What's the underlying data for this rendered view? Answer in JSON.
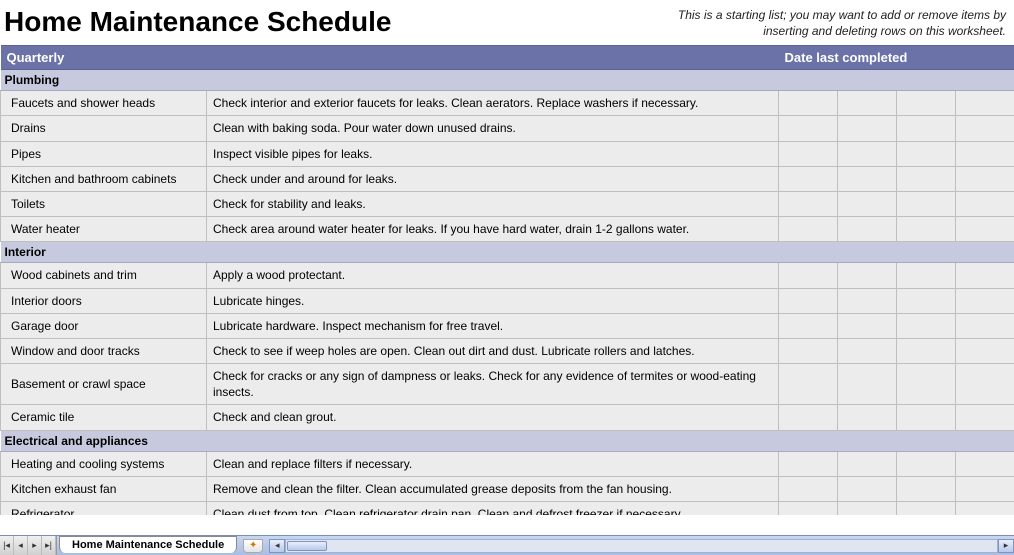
{
  "title": "Home Maintenance Schedule",
  "note": "This is a starting list; you may want to add or remove items by inserting and deleting rows on this worksheet.",
  "header": {
    "left": "Quarterly",
    "right": "Date last completed"
  },
  "sections": [
    {
      "name": "Plumbing",
      "rows": [
        {
          "item": "Faucets and shower heads",
          "desc": "Check interior and exterior faucets for leaks. Clean aerators. Replace washers if necessary."
        },
        {
          "item": "Drains",
          "desc": "Clean with baking soda. Pour water down unused drains."
        },
        {
          "item": "Pipes",
          "desc": "Inspect visible pipes for leaks."
        },
        {
          "item": "Kitchen and bathroom cabinets",
          "desc": "Check under and around for leaks."
        },
        {
          "item": "Toilets",
          "desc": "Check for stability and leaks."
        },
        {
          "item": "Water heater",
          "desc": "Check area around water heater for leaks. If you have hard water, drain 1-2 gallons water."
        }
      ]
    },
    {
      "name": "Interior",
      "rows": [
        {
          "item": "Wood cabinets and trim",
          "desc": "Apply a wood protectant."
        },
        {
          "item": "Interior doors",
          "desc": "Lubricate hinges."
        },
        {
          "item": "Garage door",
          "desc": "Lubricate hardware. Inspect mechanism for free travel."
        },
        {
          "item": "Window and door tracks",
          "desc": "Check to see if weep holes are open. Clean out dirt and dust. Lubricate rollers and latches."
        },
        {
          "item": "Basement or crawl space",
          "desc": "Check for cracks or any sign of dampness or leaks. Check for any evidence of termites or wood-eating insects."
        },
        {
          "item": "Ceramic tile",
          "desc": "Check and clean grout."
        }
      ]
    },
    {
      "name": "Electrical and appliances",
      "rows": [
        {
          "item": "Heating and cooling systems",
          "desc": "Clean and replace filters if necessary."
        },
        {
          "item": "Kitchen exhaust fan",
          "desc": "Remove and clean the filter. Clean accumulated grease deposits from the fan housing."
        },
        {
          "item": "Refrigerator",
          "desc": "Clean dust from top. Clean refrigerator drain pan. Clean and defrost freezer if necessary."
        }
      ]
    }
  ],
  "tab": {
    "name": "Home Maintenance Schedule"
  }
}
